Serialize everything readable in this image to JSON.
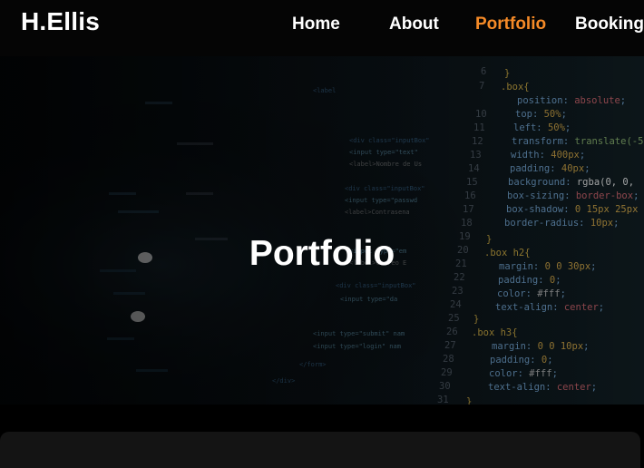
{
  "brand": {
    "logo_text": "H.Ellis"
  },
  "nav": {
    "items": [
      {
        "label": "Home",
        "active": false
      },
      {
        "label": "About",
        "active": false
      },
      {
        "label": "Portfolio",
        "active": true
      },
      {
        "label": "Booking",
        "active": false
      }
    ],
    "active_color": "#f58a27"
  },
  "hero": {
    "title": "Portfolio"
  }
}
